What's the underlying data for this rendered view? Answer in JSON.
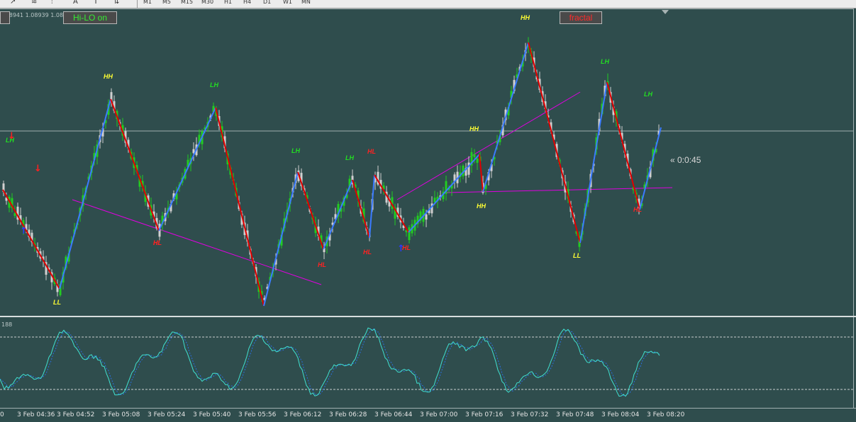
{
  "toolbar": {
    "icons": [
      "line-tool-icon",
      "fibo-icon",
      "fibo-fan-icon",
      "text-icon",
      "label-icon",
      "arrows-icon"
    ],
    "timeframes": [
      "M1",
      "M5",
      "M15",
      "M30",
      "H1",
      "H4",
      "D1",
      "W1",
      "MN"
    ]
  },
  "chart": {
    "ohlc_text": "1.08941 1.08939 1.08",
    "buttons": {
      "left_stub": "",
      "hilo": "Hi-LO on",
      "fractal": "fractal"
    },
    "timer": "« 0:0:45",
    "oscillator_label": "188",
    "colors": {
      "background": "#2f4d4d",
      "bull_candle": "#22cc22",
      "bear_candle": "#d0d0d0",
      "zigzag_up": "#3b7bff",
      "zigzag_down": "#e00000",
      "trendline": "#e000e0",
      "oscillator": "#40e0d0"
    },
    "zigzag_labels": [
      {
        "text": "LH",
        "kind": "lh"
      },
      {
        "text": "LL",
        "kind": "ll"
      },
      {
        "text": "HH",
        "kind": "hh"
      },
      {
        "text": "HL",
        "kind": "hl"
      },
      {
        "text": "LH",
        "kind": "lh"
      },
      {
        "text": "HL",
        "kind": "hl"
      },
      {
        "text": "LH",
        "kind": "lh"
      },
      {
        "text": "HL",
        "kind": "hl"
      },
      {
        "text": "LH",
        "kind": "lh"
      },
      {
        "text": "HH",
        "kind": "hh"
      },
      {
        "text": "HL",
        "kind": "hl"
      },
      {
        "text": "HL",
        "kind": "hl"
      },
      {
        "text": "HH",
        "kind": "hh"
      },
      {
        "text": "HL",
        "kind": "hl"
      },
      {
        "text": "HH",
        "kind": "hh"
      },
      {
        "text": "LL",
        "kind": "ll"
      },
      {
        "text": "LH",
        "kind": "lh"
      },
      {
        "text": "LH",
        "kind": "lh"
      },
      {
        "text": "HL",
        "kind": "hl"
      }
    ],
    "signal_arrows": [
      "down",
      "down",
      "up",
      "up"
    ]
  },
  "time_axis": {
    "labels": [
      "0",
      "3 Feb 04:36",
      "3 Feb 04:52",
      "3 Feb 05:08",
      "3 Feb 05:24",
      "3 Feb 05:40",
      "3 Feb 05:56",
      "3 Feb 06:12",
      "3 Feb 06:28",
      "3 Feb 06:44",
      "3 Feb 07:00",
      "3 Feb 07:16",
      "3 Feb 07:32",
      "3 Feb 07:48",
      "3 Feb 08:04",
      "3 Feb 08:20"
    ]
  }
}
